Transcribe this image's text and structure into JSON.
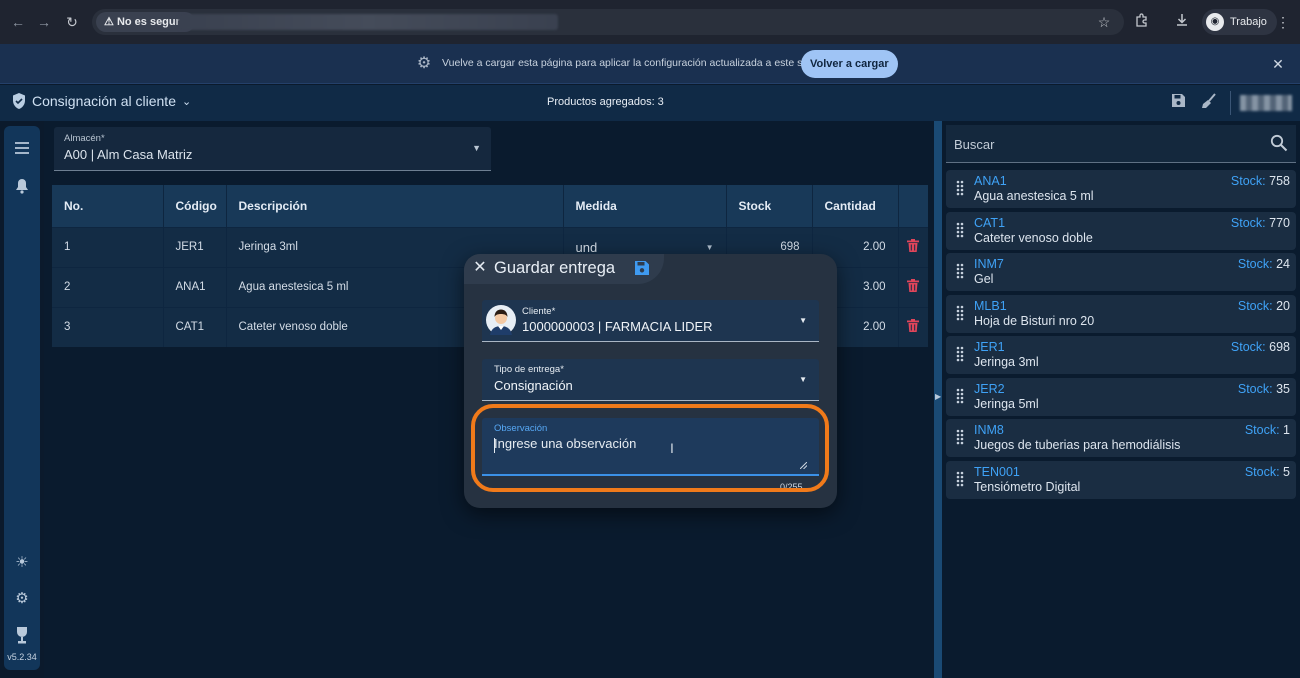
{
  "browser": {
    "security_label": "No es seguro",
    "profile_label": "Trabajo"
  },
  "infobar": {
    "message": "Vuelve a cargar esta página para aplicar la configuración actualizada a este sitio",
    "reload_label": "Volver a cargar"
  },
  "app": {
    "title": "Consignación al cliente",
    "products_added": "Productos agregados: 3",
    "version": "v5.2.34"
  },
  "warehouse": {
    "label": "Almacén*",
    "value": "A00 | Alm Casa Matriz"
  },
  "table": {
    "headers": [
      "No.",
      "Código",
      "Descripción",
      "Medida",
      "Stock",
      "Cantidad"
    ],
    "rows": [
      {
        "no": "1",
        "code": "JER1",
        "desc": "Jeringa 3ml",
        "medida": "und",
        "stock": "698",
        "qty": "2.00"
      },
      {
        "no": "2",
        "code": "ANA1",
        "desc": "Agua anestesica 5 ml",
        "medida": "",
        "stock": "",
        "qty": "3.00"
      },
      {
        "no": "3",
        "code": "CAT1",
        "desc": "Cateter venoso doble",
        "medida": "",
        "stock": "",
        "qty": "2.00"
      }
    ]
  },
  "search": {
    "placeholder": "Buscar"
  },
  "stock_label": "Stock:",
  "products": [
    {
      "code": "ANA1",
      "desc": "Agua anestesica 5 ml",
      "stock": "758"
    },
    {
      "code": "CAT1",
      "desc": "Cateter venoso doble",
      "stock": "770"
    },
    {
      "code": "INM7",
      "desc": "Gel",
      "stock": "24"
    },
    {
      "code": "MLB1",
      "desc": "Hoja de Bisturi nro 20",
      "stock": "20"
    },
    {
      "code": "JER1",
      "desc": "Jeringa 3ml",
      "stock": "698"
    },
    {
      "code": "JER2",
      "desc": "Jeringa 5ml",
      "stock": "35"
    },
    {
      "code": "INM8",
      "desc": "Juegos de tuberias para hemodiálisis",
      "stock": "1"
    },
    {
      "code": "TEN001",
      "desc": "Tensiómetro Digital",
      "stock": "5"
    }
  ],
  "dialog": {
    "title": "Guardar entrega",
    "client_label": "Cliente*",
    "client_value": "1000000003 | FARMACIA LIDER",
    "delivery_label": "Tipo de entrega*",
    "delivery_value": "Consignación",
    "obs_label": "Observación",
    "obs_placeholder": "Ingrese una observación",
    "obs_counter": "0/255"
  },
  "colors": {
    "accent": "#3fa2f6",
    "highlight": "#f07a1a",
    "danger": "#e0455a"
  }
}
